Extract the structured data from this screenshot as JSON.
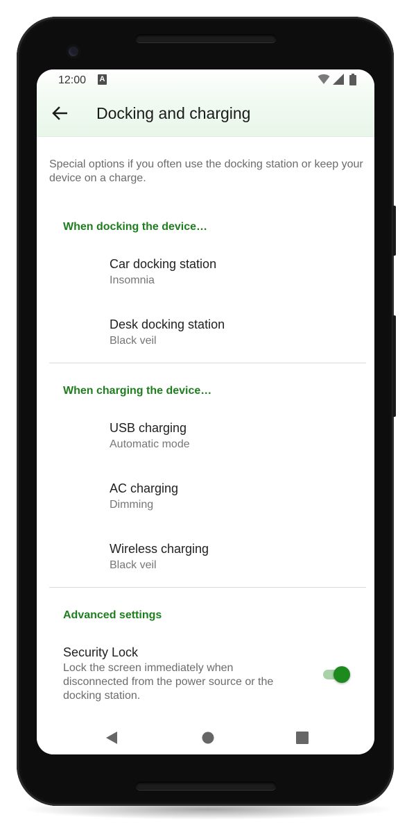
{
  "status_bar": {
    "time": "12:00",
    "notification_badge": "A",
    "icons": [
      "wifi-icon",
      "cell-signal-icon",
      "battery-icon"
    ]
  },
  "app_bar": {
    "title": "Docking and charging",
    "back_icon": "arrow-back-icon"
  },
  "intro_text": "Special options if you often use the docking station or keep your device on a charge.",
  "sections": [
    {
      "header": "When docking the device…",
      "items": [
        {
          "title": "Car docking station",
          "subtitle": "Insomnia"
        },
        {
          "title": "Desk docking station",
          "subtitle": "Black veil"
        }
      ]
    },
    {
      "header": "When charging the device…",
      "items": [
        {
          "title": "USB charging",
          "subtitle": "Automatic mode"
        },
        {
          "title": "AC charging",
          "subtitle": "Dimming"
        },
        {
          "title": "Wireless charging",
          "subtitle": "Black veil"
        }
      ]
    },
    {
      "header": "Advanced settings",
      "security_lock": {
        "title": "Security Lock",
        "description": "Lock the screen immediately when disconnected from the power source or the docking station.",
        "enabled": true
      }
    }
  ],
  "nav_bar": {
    "icons": [
      "back-triangle-icon",
      "home-circle-icon",
      "recents-square-icon"
    ]
  },
  "colors": {
    "accent": "#1c8a1c",
    "section_header": "#1e7e1e",
    "app_bar_tint": "#e9f6ea"
  }
}
